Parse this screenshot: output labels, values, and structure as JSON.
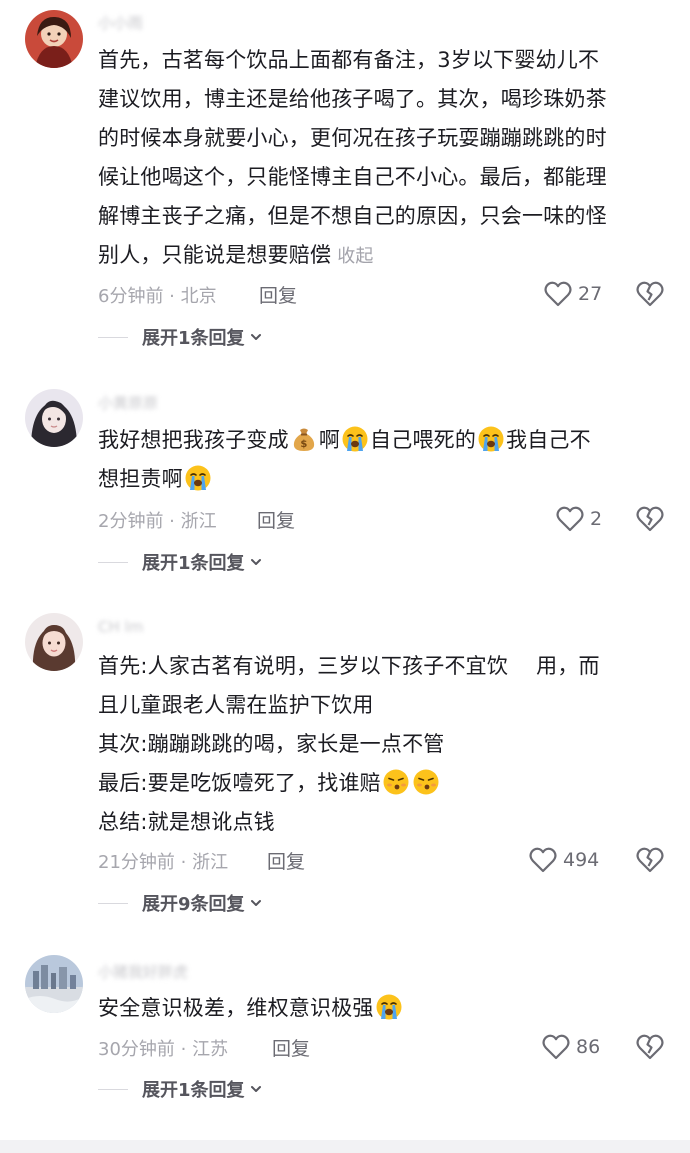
{
  "comments": [
    {
      "username": "小小雨",
      "text_lines": [
        "首先，古茗每个饮品上面都有备注，3岁以下婴幼儿不",
        "建议饮用，博主还是给他孩子喝了。其次，喝珍珠奶茶",
        "的时候本身就要小心，更何况在孩子玩耍蹦蹦跳跳的时",
        "候让他喝这个，只能怪博主自己不小心。最后，都能理",
        "解博主丧子之痛，但是不想自己的原因，只会一味的怪",
        "别人，只能说是想要赔偿"
      ],
      "collapse_label": "收起",
      "time_location": "6分钟前 · 北京",
      "reply_label": "回复",
      "likes": "27",
      "expand_label": "展开1条回复"
    },
    {
      "username": "小黄原原",
      "seg1": "我好想把我孩子变成",
      "seg2": "啊",
      "seg3": "自己喂死的",
      "seg4": "我自己不",
      "seg5": "想担责啊",
      "time_location": "2分钟前 · 浙江",
      "reply_label": "回复",
      "likes": "2",
      "expand_label": "展开1条回复"
    },
    {
      "username": "CH  lm",
      "line1": "首先:人家古茗有说明，三岁以下孩子不宜饮　 用，而",
      "line2": "且儿童跟老人需在监护下饮用",
      "line3": "其次:蹦蹦跳跳的喝，家长是一点不管",
      "line4": "最后:要是吃饭噎死了，找谁赔",
      "line5": "总结:就是想讹点钱",
      "time_location": "21分钟前 · 浙江",
      "reply_label": "回复",
      "likes": "494",
      "expand_label": "展开9条回复"
    },
    {
      "username": "小猪我好胖虎",
      "text": "安全意识极差，维权意识极强",
      "time_location": "30分钟前 · 江苏",
      "reply_label": "回复",
      "likes": "86",
      "expand_label": "展开1条回复"
    }
  ],
  "icons": {
    "heart": "heart-outline-icon",
    "dislike": "broken-heart-icon",
    "chevron": "chevron-down-icon",
    "money_bag": "money-bag-emoji",
    "crying_face": "loudly-crying-face-emoji",
    "blowing_face": "face-blowing-emoji"
  },
  "colors": {
    "text": "#1c1c22",
    "meta": "#a6a6ad",
    "action": "#6b6b73"
  }
}
